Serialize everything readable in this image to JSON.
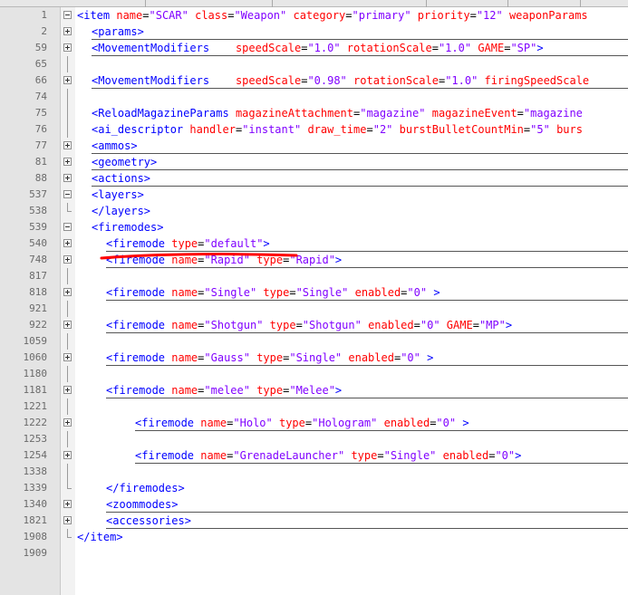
{
  "editor": {
    "lines": [
      {
        "no": "1",
        "fold": "minus",
        "indent": 0,
        "ul": false,
        "toks": [
          [
            "tag",
            "<item "
          ],
          [
            "attr",
            "name"
          ],
          [
            "eq",
            "="
          ],
          [
            "val",
            "\"SCAR\""
          ],
          [
            "tag",
            " "
          ],
          [
            "attr",
            "class"
          ],
          [
            "eq",
            "="
          ],
          [
            "val",
            "\"Weapon\""
          ],
          [
            "tag",
            " "
          ],
          [
            "attr",
            "category"
          ],
          [
            "eq",
            "="
          ],
          [
            "val",
            "\"primary\""
          ],
          [
            "tag",
            " "
          ],
          [
            "attr",
            "priority"
          ],
          [
            "eq",
            "="
          ],
          [
            "val",
            "\"12\""
          ],
          [
            "tag",
            " "
          ],
          [
            "attr",
            "weaponParams"
          ]
        ]
      },
      {
        "no": "2",
        "fold": "plus",
        "indent": 1,
        "ul": true,
        "toks": [
          [
            "tag",
            "<params>"
          ]
        ]
      },
      {
        "no": "59",
        "fold": "plus",
        "indent": 1,
        "ul": true,
        "toks": [
          [
            "tag",
            "<MovementModifiers    "
          ],
          [
            "attr",
            "speedScale"
          ],
          [
            "eq",
            "="
          ],
          [
            "val",
            "\"1.0\""
          ],
          [
            "tag",
            " "
          ],
          [
            "attr",
            "rotationScale"
          ],
          [
            "eq",
            "="
          ],
          [
            "val",
            "\"1.0\""
          ],
          [
            "tag",
            " "
          ],
          [
            "attr",
            "GAME"
          ],
          [
            "eq",
            "="
          ],
          [
            "val",
            "\"SP\""
          ],
          [
            "tag",
            ">"
          ]
        ]
      },
      {
        "no": "65",
        "fold": "vline",
        "indent": 0,
        "ul": false,
        "toks": []
      },
      {
        "no": "66",
        "fold": "plus",
        "indent": 1,
        "ul": true,
        "toks": [
          [
            "tag",
            "<MovementModifiers    "
          ],
          [
            "attr",
            "speedScale"
          ],
          [
            "eq",
            "="
          ],
          [
            "val",
            "\"0.98\""
          ],
          [
            "tag",
            " "
          ],
          [
            "attr",
            "rotationScale"
          ],
          [
            "eq",
            "="
          ],
          [
            "val",
            "\"1.0\""
          ],
          [
            "tag",
            " "
          ],
          [
            "attr",
            "firingSpeedScale"
          ]
        ]
      },
      {
        "no": "74",
        "fold": "vline",
        "indent": 0,
        "ul": false,
        "toks": []
      },
      {
        "no": "75",
        "fold": "vline",
        "indent": 1,
        "ul": false,
        "toks": [
          [
            "tag",
            "<ReloadMagazineParams "
          ],
          [
            "attr",
            "magazineAttachment"
          ],
          [
            "eq",
            "="
          ],
          [
            "val",
            "\"magazine\""
          ],
          [
            "tag",
            " "
          ],
          [
            "attr",
            "magazineEvent"
          ],
          [
            "eq",
            "="
          ],
          [
            "val",
            "\"magazine"
          ]
        ]
      },
      {
        "no": "76",
        "fold": "vline",
        "indent": 1,
        "ul": false,
        "toks": [
          [
            "tag",
            "<ai_descriptor "
          ],
          [
            "attr",
            "handler"
          ],
          [
            "eq",
            "="
          ],
          [
            "val",
            "\"instant\""
          ],
          [
            "tag",
            " "
          ],
          [
            "attr",
            "draw_time"
          ],
          [
            "eq",
            "="
          ],
          [
            "val",
            "\"2\""
          ],
          [
            "tag",
            " "
          ],
          [
            "attr",
            "burstBulletCountMin"
          ],
          [
            "eq",
            "="
          ],
          [
            "val",
            "\"5\""
          ],
          [
            "tag",
            " "
          ],
          [
            "attr",
            "burs"
          ]
        ]
      },
      {
        "no": "77",
        "fold": "plus",
        "indent": 1,
        "ul": true,
        "toks": [
          [
            "tag",
            "<ammos>"
          ]
        ]
      },
      {
        "no": "81",
        "fold": "plus",
        "indent": 1,
        "ul": true,
        "toks": [
          [
            "tag",
            "<geometry>"
          ]
        ]
      },
      {
        "no": "88",
        "fold": "plus",
        "indent": 1,
        "ul": true,
        "toks": [
          [
            "tag",
            "<actions>"
          ]
        ]
      },
      {
        "no": "537",
        "fold": "minus",
        "indent": 1,
        "ul": false,
        "toks": [
          [
            "tag",
            "<layers>"
          ]
        ]
      },
      {
        "no": "538",
        "fold": "corner",
        "indent": 1,
        "ul": false,
        "toks": [
          [
            "tag",
            "</layers>"
          ]
        ]
      },
      {
        "no": "539",
        "fold": "minus",
        "indent": 1,
        "ul": false,
        "toks": [
          [
            "tag",
            "<firemodes>"
          ]
        ]
      },
      {
        "no": "540",
        "fold": "plus",
        "indent": 2,
        "ul": true,
        "toks": [
          [
            "tag",
            "<firemode "
          ],
          [
            "attr",
            "type"
          ],
          [
            "eq",
            "="
          ],
          [
            "val",
            "\"default\""
          ],
          [
            "tag",
            ">"
          ]
        ]
      },
      {
        "no": "748",
        "fold": "plus",
        "indent": 2,
        "ul": true,
        "toks": [
          [
            "tag",
            "<firemode "
          ],
          [
            "attr",
            "name"
          ],
          [
            "eq",
            "="
          ],
          [
            "val",
            "\"Rapid\""
          ],
          [
            "tag",
            " "
          ],
          [
            "attr",
            "type"
          ],
          [
            "eq",
            "="
          ],
          [
            "val",
            "\"Rapid\""
          ],
          [
            "tag",
            ">"
          ]
        ]
      },
      {
        "no": "817",
        "fold": "vline",
        "indent": 0,
        "ul": false,
        "toks": []
      },
      {
        "no": "818",
        "fold": "plus",
        "indent": 2,
        "ul": true,
        "toks": [
          [
            "tag",
            "<firemode "
          ],
          [
            "attr",
            "name"
          ],
          [
            "eq",
            "="
          ],
          [
            "val",
            "\"Single\""
          ],
          [
            "tag",
            " "
          ],
          [
            "attr",
            "type"
          ],
          [
            "eq",
            "="
          ],
          [
            "val",
            "\"Single\""
          ],
          [
            "tag",
            " "
          ],
          [
            "attr",
            "enabled"
          ],
          [
            "eq",
            "="
          ],
          [
            "val",
            "\"0\""
          ],
          [
            "tag",
            " >"
          ]
        ]
      },
      {
        "no": "921",
        "fold": "vline",
        "indent": 0,
        "ul": false,
        "toks": []
      },
      {
        "no": "922",
        "fold": "plus",
        "indent": 2,
        "ul": true,
        "toks": [
          [
            "tag",
            "<firemode "
          ],
          [
            "attr",
            "name"
          ],
          [
            "eq",
            "="
          ],
          [
            "val",
            "\"Shotgun\""
          ],
          [
            "tag",
            " "
          ],
          [
            "attr",
            "type"
          ],
          [
            "eq",
            "="
          ],
          [
            "val",
            "\"Shotgun\""
          ],
          [
            "tag",
            " "
          ],
          [
            "attr",
            "enabled"
          ],
          [
            "eq",
            "="
          ],
          [
            "val",
            "\"0\""
          ],
          [
            "tag",
            " "
          ],
          [
            "attr",
            "GAME"
          ],
          [
            "eq",
            "="
          ],
          [
            "val",
            "\"MP\""
          ],
          [
            "tag",
            ">"
          ]
        ]
      },
      {
        "no": "1059",
        "fold": "vline",
        "indent": 0,
        "ul": false,
        "toks": []
      },
      {
        "no": "1060",
        "fold": "plus",
        "indent": 2,
        "ul": true,
        "toks": [
          [
            "tag",
            "<firemode "
          ],
          [
            "attr",
            "name"
          ],
          [
            "eq",
            "="
          ],
          [
            "val",
            "\"Gauss\""
          ],
          [
            "tag",
            " "
          ],
          [
            "attr",
            "type"
          ],
          [
            "eq",
            "="
          ],
          [
            "val",
            "\"Single\""
          ],
          [
            "tag",
            " "
          ],
          [
            "attr",
            "enabled"
          ],
          [
            "eq",
            "="
          ],
          [
            "val",
            "\"0\""
          ],
          [
            "tag",
            " >"
          ]
        ]
      },
      {
        "no": "1180",
        "fold": "vline",
        "indent": 0,
        "ul": false,
        "toks": []
      },
      {
        "no": "1181",
        "fold": "plus",
        "indent": 2,
        "ul": true,
        "toks": [
          [
            "tag",
            "<firemode "
          ],
          [
            "attr",
            "name"
          ],
          [
            "eq",
            "="
          ],
          [
            "val",
            "\"melee\""
          ],
          [
            "tag",
            " "
          ],
          [
            "attr",
            "type"
          ],
          [
            "eq",
            "="
          ],
          [
            "val",
            "\"Melee\""
          ],
          [
            "tag",
            ">"
          ]
        ]
      },
      {
        "no": "1221",
        "fold": "vline",
        "indent": 0,
        "ul": false,
        "toks": []
      },
      {
        "no": "1222",
        "fold": "plus",
        "indent": 4,
        "ul": true,
        "toks": [
          [
            "tag",
            "<firemode "
          ],
          [
            "attr",
            "name"
          ],
          [
            "eq",
            "="
          ],
          [
            "val",
            "\"Holo\""
          ],
          [
            "tag",
            " "
          ],
          [
            "attr",
            "type"
          ],
          [
            "eq",
            "="
          ],
          [
            "val",
            "\"Hologram\""
          ],
          [
            "tag",
            " "
          ],
          [
            "attr",
            "enabled"
          ],
          [
            "eq",
            "="
          ],
          [
            "val",
            "\"0\""
          ],
          [
            "tag",
            " >"
          ]
        ]
      },
      {
        "no": "1253",
        "fold": "vline",
        "indent": 0,
        "ul": false,
        "toks": []
      },
      {
        "no": "1254",
        "fold": "plus",
        "indent": 4,
        "ul": true,
        "toks": [
          [
            "tag",
            "<firemode "
          ],
          [
            "attr",
            "name"
          ],
          [
            "eq",
            "="
          ],
          [
            "val",
            "\"GrenadeLauncher\""
          ],
          [
            "tag",
            " "
          ],
          [
            "attr",
            "type"
          ],
          [
            "eq",
            "="
          ],
          [
            "val",
            "\"Single\""
          ],
          [
            "tag",
            " "
          ],
          [
            "attr",
            "enabled"
          ],
          [
            "eq",
            "="
          ],
          [
            "val",
            "\"0\""
          ],
          [
            "tag",
            ">"
          ]
        ]
      },
      {
        "no": "1338",
        "fold": "vline",
        "indent": 0,
        "ul": false,
        "toks": []
      },
      {
        "no": "1339",
        "fold": "corner",
        "indent": 2,
        "ul": false,
        "toks": [
          [
            "tag",
            "</firemodes>"
          ]
        ]
      },
      {
        "no": "1340",
        "fold": "plus",
        "indent": 2,
        "ul": true,
        "toks": [
          [
            "tag",
            "<zoommodes>"
          ]
        ]
      },
      {
        "no": "1821",
        "fold": "plus",
        "indent": 2,
        "ul": true,
        "toks": [
          [
            "tag",
            "<accessories>"
          ]
        ]
      },
      {
        "no": "1908",
        "fold": "corner",
        "indent": 0,
        "ul": false,
        "toks": [
          [
            "tag",
            "</item>"
          ]
        ]
      },
      {
        "no": "1909",
        "fold": "none",
        "indent": 0,
        "ul": false,
        "toks": []
      }
    ]
  },
  "colors": {
    "tag": "#0000ff",
    "attribute": "#ff0000",
    "value": "#8000ff",
    "annotation_stroke": "#ff0000"
  },
  "annotation": {
    "type": "hand-drawn red strike-through",
    "target_line": "748"
  }
}
